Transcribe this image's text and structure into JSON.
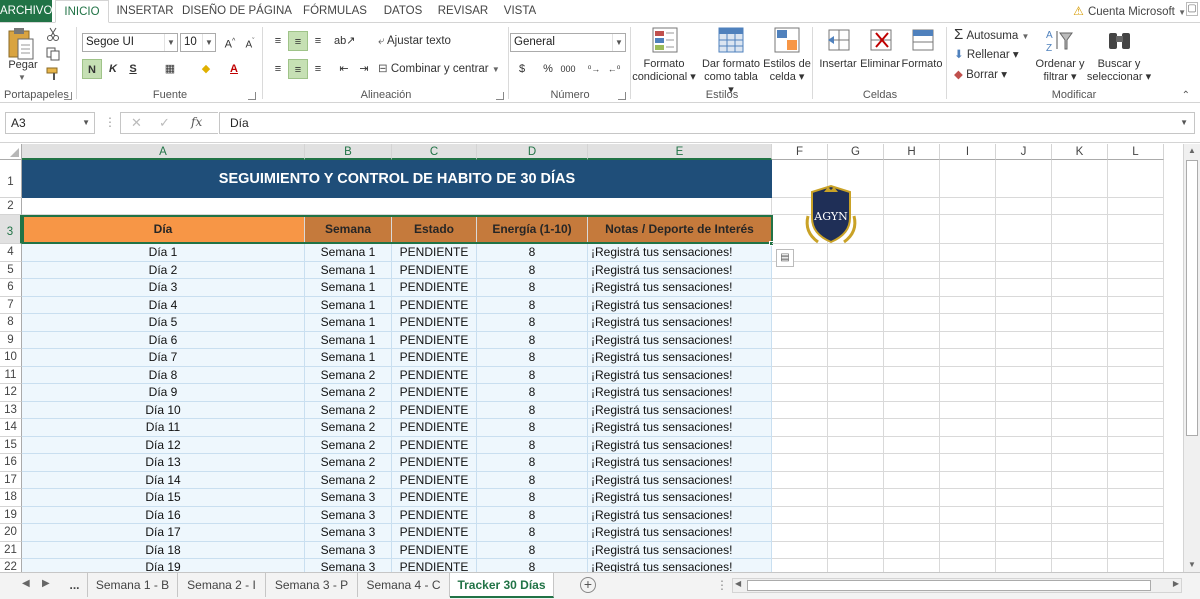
{
  "tabs": [
    "ARCHIVO",
    "INICIO",
    "INSERTAR",
    "DISEÑO DE PÁGINA",
    "FÓRMULAS",
    "DATOS",
    "REVISAR",
    "VISTA"
  ],
  "account": "Cuenta Microsoft",
  "ribbon": {
    "clipboard": {
      "paste": "Pegar",
      "label": "Portapapeles"
    },
    "font": {
      "name": "Segoe UI",
      "size": "10",
      "bold": "N",
      "italic": "K",
      "underline": "S",
      "label": "Fuente"
    },
    "alignment": {
      "wrap": "Ajustar texto",
      "merge": "Combinar y centrar",
      "label": "Alineación"
    },
    "number": {
      "format": "General",
      "currency": "$",
      "percent": "%",
      "thousands": "000",
      "label": "Número"
    },
    "styles": {
      "conditional": [
        "Formato",
        "condicional"
      ],
      "table": [
        "Dar formato",
        "como tabla"
      ],
      "cell": [
        "Estilos de",
        "celda"
      ],
      "label": "Estilos"
    },
    "cells": {
      "insert": "Insertar",
      "delete": "Eliminar",
      "format": "Formato",
      "label": "Celdas"
    },
    "editing": {
      "autosum": "Autosuma",
      "fill": "Rellenar",
      "clear": "Borrar",
      "sort": [
        "Ordenar y",
        "filtrar"
      ],
      "find": [
        "Buscar y",
        "seleccionar"
      ],
      "label": "Modificar"
    }
  },
  "formula_bar": {
    "name_box": "A3",
    "fx": "fx",
    "content": "Día"
  },
  "columns": [
    "A",
    "B",
    "C",
    "D",
    "E",
    "F",
    "G",
    "H",
    "I",
    "J",
    "K",
    "L"
  ],
  "sheet": {
    "title": "SEGUIMIENTO Y CONTROL DE HABITO DE 30 DÍAS",
    "logo_text": "AGYN",
    "headers": [
      "Día",
      "Semana",
      "Estado",
      "Energía (1-10)",
      "Notas / Deporte de Interés"
    ],
    "rows": [
      [
        "Día 1",
        "Semana 1",
        "PENDIENTE",
        "8",
        "¡Registrá tus sensaciones!"
      ],
      [
        "Día 2",
        "Semana 1",
        "PENDIENTE",
        "8",
        "¡Registrá tus sensaciones!"
      ],
      [
        "Día 3",
        "Semana 1",
        "PENDIENTE",
        "8",
        "¡Registrá tus sensaciones!"
      ],
      [
        "Día 4",
        "Semana 1",
        "PENDIENTE",
        "8",
        "¡Registrá tus sensaciones!"
      ],
      [
        "Día 5",
        "Semana 1",
        "PENDIENTE",
        "8",
        "¡Registrá tus sensaciones!"
      ],
      [
        "Día 6",
        "Semana 1",
        "PENDIENTE",
        "8",
        "¡Registrá tus sensaciones!"
      ],
      [
        "Día 7",
        "Semana 1",
        "PENDIENTE",
        "8",
        "¡Registrá tus sensaciones!"
      ],
      [
        "Día 8",
        "Semana 2",
        "PENDIENTE",
        "8",
        "¡Registrá tus sensaciones!"
      ],
      [
        "Día 9",
        "Semana 2",
        "PENDIENTE",
        "8",
        "¡Registrá tus sensaciones!"
      ],
      [
        "Día 10",
        "Semana 2",
        "PENDIENTE",
        "8",
        "¡Registrá tus sensaciones!"
      ],
      [
        "Día 11",
        "Semana 2",
        "PENDIENTE",
        "8",
        "¡Registrá tus sensaciones!"
      ],
      [
        "Día 12",
        "Semana 2",
        "PENDIENTE",
        "8",
        "¡Registrá tus sensaciones!"
      ],
      [
        "Día 13",
        "Semana 2",
        "PENDIENTE",
        "8",
        "¡Registrá tus sensaciones!"
      ],
      [
        "Día 14",
        "Semana 2",
        "PENDIENTE",
        "8",
        "¡Registrá tus sensaciones!"
      ],
      [
        "Día 15",
        "Semana 3",
        "PENDIENTE",
        "8",
        "¡Registrá tus sensaciones!"
      ],
      [
        "Día 16",
        "Semana 3",
        "PENDIENTE",
        "8",
        "¡Registrá tus sensaciones!"
      ],
      [
        "Día 17",
        "Semana 3",
        "PENDIENTE",
        "8",
        "¡Registrá tus sensaciones!"
      ],
      [
        "Día 18",
        "Semana 3",
        "PENDIENTE",
        "8",
        "¡Registrá tus sensaciones!"
      ],
      [
        "Día 19",
        "Semana 3",
        "PENDIENTE",
        "8",
        "¡Registrá tus sensaciones!"
      ]
    ]
  },
  "sheet_tabs": [
    "...",
    "Semana 1 - B",
    "Semana 2 - I",
    "Semana 3 - P",
    "Semana 4 - C",
    "Tracker 30 Días"
  ],
  "colors": {
    "excel_green": "#217346",
    "title_bg": "#1f4e79",
    "header_orange": "#f79646",
    "header_dark_orange": "#c57a3c",
    "row_bg": "#eef7fd"
  }
}
